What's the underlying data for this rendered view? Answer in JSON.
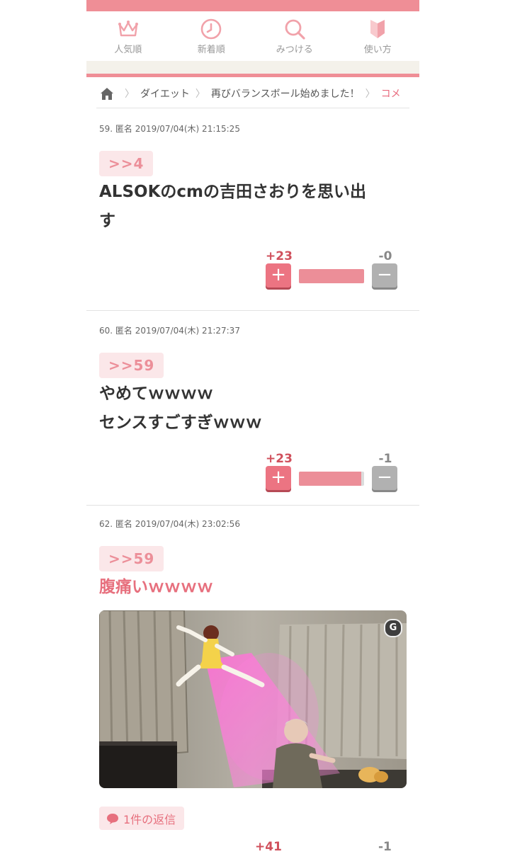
{
  "header": {
    "title": "",
    "nav": [
      {
        "label": "人気順",
        "icon": "crown-icon"
      },
      {
        "label": "新着順",
        "icon": "clock-icon"
      },
      {
        "label": "みつける",
        "icon": "search-icon"
      },
      {
        "label": "使い方",
        "icon": "beginner-mark-icon"
      }
    ]
  },
  "breadcrumb": {
    "home_icon": "home-icon",
    "items": [
      "ダイエット",
      "再びバランスボール始めました！",
      "コメ"
    ]
  },
  "comments": [
    {
      "meta": "59. 匿名 2019/07/04(木) 21:15:25",
      "anchor": ">>4",
      "lines": [
        "ALSOKのcmの吉田さおりを思い出",
        "す"
      ],
      "plus": "+23",
      "minus": "-0",
      "ratio": 1.0
    },
    {
      "meta": "60. 匿名 2019/07/04(木) 21:27:37",
      "anchor": ">>59",
      "lines": [
        "やめてｗｗｗｗ",
        "センスすごすぎｗｗｗ"
      ],
      "plus": "+23",
      "minus": "-1",
      "ratio": 0.958
    },
    {
      "meta": "62. 匿名 2019/07/04(木) 23:02:56",
      "anchor": ">>59",
      "lines": [
        "腹痛いｗｗｗｗ"
      ],
      "image_badge": "G",
      "reply": "1件の返信",
      "plus_partial": "+41",
      "minus_partial": "-1"
    }
  ],
  "colors": {
    "accent": "#ef8e96",
    "plus": "#ec7482",
    "minus": "#b1b1b1",
    "anchor_bg": "#fbe7e9"
  }
}
